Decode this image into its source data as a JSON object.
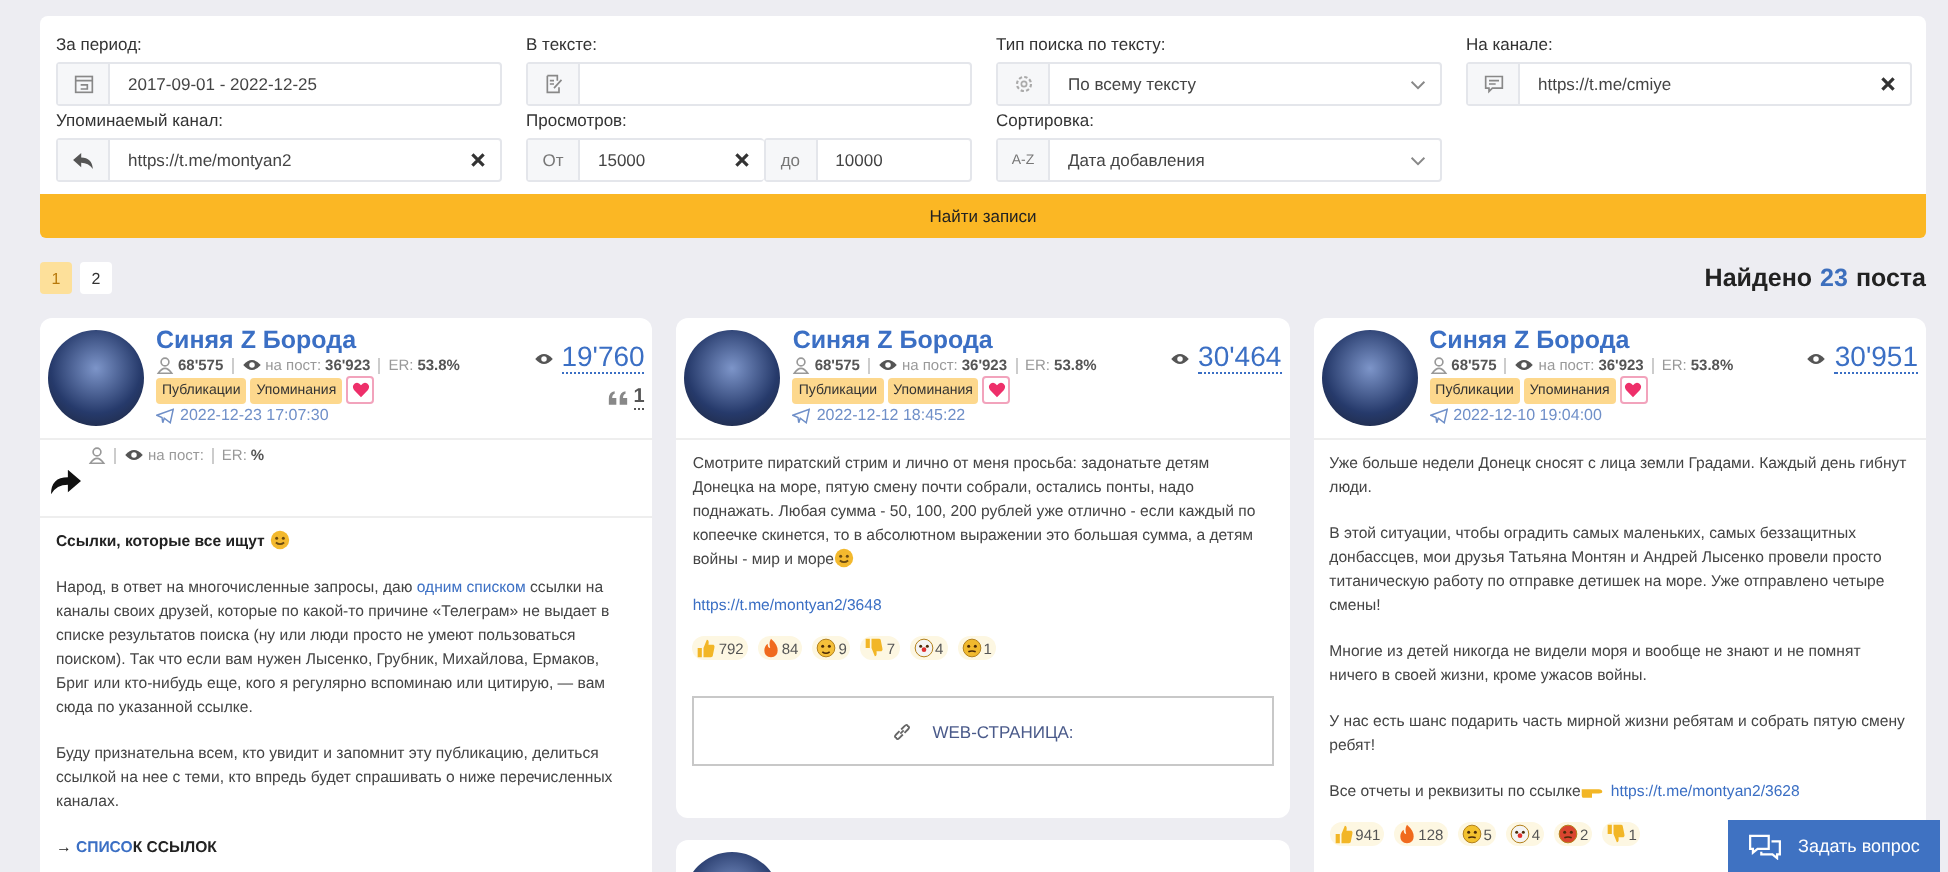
{
  "filters": {
    "period": {
      "label": "За период:",
      "value": "2017-09-01 - 2022-12-25"
    },
    "text": {
      "label": "В тексте:"
    },
    "search_type": {
      "label": "Тип поиска по тексту:",
      "value": "По всему тексту"
    },
    "channel": {
      "label": "На канале:",
      "value": "https://t.me/cmiye"
    },
    "mentioned": {
      "label": "Упоминаемый канал:",
      "value": "https://t.me/montyan2"
    },
    "views": {
      "label": "Просмотров:",
      "from_label": "От",
      "from": "15000",
      "to_label": "до",
      "to": "10000"
    },
    "sort": {
      "label": "Сортировка:",
      "prefix": "A-Z",
      "value": "Дата добавления"
    }
  },
  "search_button": "Найти записи",
  "pages": [
    {
      "label": "1",
      "selected": true
    },
    {
      "label": "2",
      "selected": false
    }
  ],
  "found": {
    "prefix": "Найдено",
    "count": "23",
    "suffix": "поста"
  },
  "columns": [
    [
      {
        "channel": "Синяя Z Борода",
        "subscribers": "68'575",
        "per_post_label": "на пост:",
        "per_post": "36'923",
        "er_label": "ER:",
        "er": "53.8%",
        "tags": [
          "Публикации",
          "Упоминания"
        ],
        "date": "2022-12-23 17:07:30",
        "views": "19'760",
        "quotes": "1",
        "forward": {
          "per_post_label": "на пост:",
          "er_label": "ER:",
          "er": "%"
        },
        "paragraphs": [
          {
            "bold": true,
            "parts": [
              {
                "kind": "text",
                "text": "Ссылки, которые все ищут "
              },
              {
                "kind": "face_emoji"
              }
            ]
          },
          {
            "bold": false,
            "parts": [
              {
                "kind": "text",
                "text": "Народ, в ответ на многочисленные запросы, даю "
              },
              {
                "kind": "link",
                "text": "одним списком"
              },
              {
                "kind": "text",
                "text": " ссылки на каналы своих друзей, которые по какой-то причине «Телеграм» не выдает в списке результатов поиска (ну или люди просто не умеют пользоваться поиском). Так что если вам нужен Лысенко, Грубник, Михайлова, Ермаков, Бриг или кто-нибудь еще, кого я регулярно вспоминаю или цитирую, — вам сюда по указанной ссылке."
              }
            ]
          },
          {
            "bold": false,
            "parts": [
              {
                "kind": "text",
                "text": "Буду признательна всем, кто увидит и запомнит эту публикацию, делиться ссылкой на нее с теми, кто впредь будет спрашивать о ниже перечисленных каналах."
              }
            ]
          },
          {
            "bold": true,
            "parts": [
              {
                "kind": "text",
                "text": "→ "
              },
              {
                "kind": "link",
                "text": "СПИСО"
              },
              {
                "kind": "text",
                "text": "К ССЫЛОК"
              }
            ]
          }
        ]
      }
    ],
    [
      {
        "channel": "Синяя Z Борода",
        "subscribers": "68'575",
        "per_post_label": "на пост:",
        "per_post": "36'923",
        "er_label": "ER:",
        "er": "53.8%",
        "tags": [
          "Публикации",
          "Упоминания"
        ],
        "date": "2022-12-12 18:45:22",
        "views": "30'464",
        "paragraphs": [
          {
            "bold": false,
            "parts": [
              {
                "kind": "text",
                "text": "Смотрите пиратский стрим и лично от меня просьба: задонатьте детям Донецка на море, пятую смену почти собрали, остались понты, надо поднажать. Любая сумма - 50, 100, 200 рублей уже отлично - если каждый по копеечке скинется, то в абсолютном выражении это большая сумма, а детям войны - мир и море"
              },
              {
                "kind": "face_emoji"
              }
            ]
          },
          {
            "bold": false,
            "parts": [
              {
                "kind": "link",
                "text": "https://t.me/montyan2/3648"
              }
            ]
          }
        ],
        "reactions": [
          {
            "kind": "thumbs_up",
            "count": "792"
          },
          {
            "kind": "fire",
            "count": "84"
          },
          {
            "kind": "grin",
            "count": "9"
          },
          {
            "kind": "thumbs_down",
            "count": "7"
          },
          {
            "kind": "clown",
            "count": "4"
          },
          {
            "kind": "confused",
            "count": "1"
          }
        ],
        "web_button": "WEB-СТРАНИЦА:"
      },
      {}
    ],
    [
      {
        "channel": "Синяя Z Борода",
        "subscribers": "68'575",
        "per_post_label": "на пост:",
        "per_post": "36'923",
        "er_label": "ER:",
        "er": "53.8%",
        "tags": [
          "Публикации",
          "Упоминания"
        ],
        "date": "2022-12-10 19:04:00",
        "views": "30'951",
        "paragraphs": [
          {
            "bold": false,
            "parts": [
              {
                "kind": "text",
                "text": "Уже больше недели Донецк сносят с лица земли Градами. Каждый день гибнут люди."
              }
            ]
          },
          {
            "bold": false,
            "parts": [
              {
                "kind": "text",
                "text": "В этой ситуации, чтобы оградить самых маленьких, самых беззащитных донбассцев, мои друзья Татьяна Монтян и Андрей Лысенко провели просто титаническую работу по отправке детишек на море. Уже отправлено четыре смены!"
              }
            ]
          },
          {
            "bold": false,
            "parts": [
              {
                "kind": "text",
                "text": "Многие из детей никогда не видели моря и вообще не знают и не помнят ничего в своей жизни, кроме ужасов войны."
              }
            ]
          },
          {
            "bold": false,
            "parts": [
              {
                "kind": "text",
                "text": "У нас есть шанс подарить часть мирной жизни ребятам и собрать пятую смену ребят!"
              }
            ]
          },
          {
            "bold": false,
            "parts": [
              {
                "kind": "text",
                "text": "Все отчеты и реквизиты по ссылке"
              },
              {
                "kind": "hand_emoji"
              },
              {
                "kind": "link",
                "text": "https://t.me/montyan2/3628"
              }
            ]
          }
        ],
        "reactions": [
          {
            "kind": "thumbs_up",
            "count": "941"
          },
          {
            "kind": "fire",
            "count": "128"
          },
          {
            "kind": "dizzy",
            "count": "5"
          },
          {
            "kind": "clown",
            "count": "4"
          },
          {
            "kind": "angry",
            "count": "2"
          },
          {
            "kind": "thumbs_down",
            "count": "1"
          }
        ]
      }
    ]
  ],
  "ask_button": "Задать вопрос"
}
